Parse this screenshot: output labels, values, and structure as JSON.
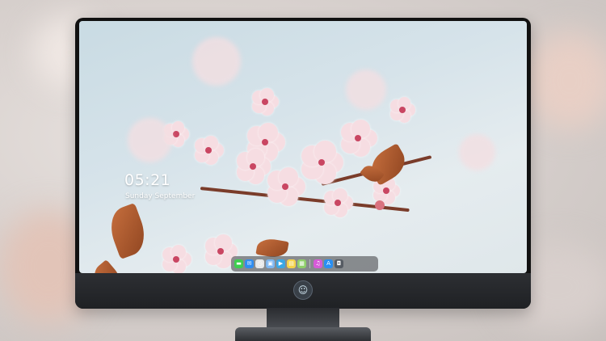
{
  "lock_screen": {
    "time": "05:21",
    "date": "Sunday September"
  },
  "dock": {
    "items": [
      {
        "icon": "messages-icon",
        "color": "#3ecf4f",
        "glyph": "▬"
      },
      {
        "icon": "mail-icon",
        "color": "#2f8df0",
        "glyph": "✉"
      },
      {
        "icon": "clock-icon",
        "color": "#e8e8e8",
        "glyph": "◷"
      },
      {
        "icon": "finder-icon",
        "color": "#7fb7f0",
        "glyph": "▣"
      },
      {
        "icon": "video-icon",
        "color": "#3aa7e6",
        "glyph": "▶"
      },
      {
        "icon": "notes-icon",
        "color": "#f4d34a",
        "glyph": "▤"
      },
      {
        "icon": "photos-icon",
        "color": "#8fcf6a",
        "glyph": "▦"
      },
      {
        "icon": "music-icon",
        "color": "#d65ad8",
        "glyph": "♫"
      },
      {
        "icon": "app-store-icon",
        "color": "#2a8ff2",
        "glyph": "A"
      },
      {
        "icon": "camera-icon",
        "color": "#555b63",
        "glyph": "◘"
      }
    ]
  },
  "colors": {
    "petal": "#f6dde2",
    "petal_center": "#c94662",
    "leaf": "#c9713f"
  }
}
